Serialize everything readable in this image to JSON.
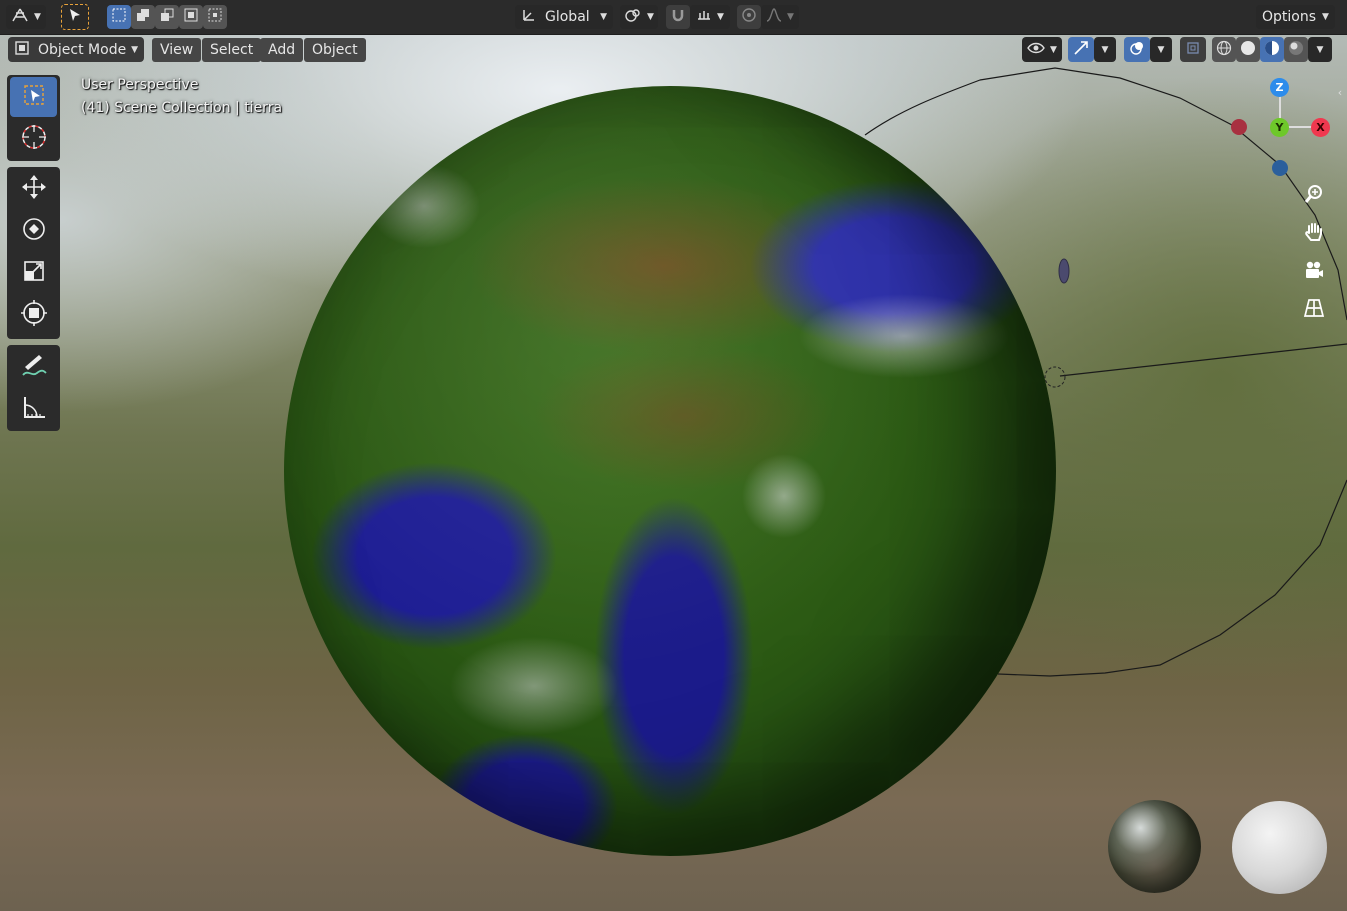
{
  "header": {
    "transform_orientation": "Global",
    "options_label": "Options"
  },
  "viewport_header": {
    "mode_label": "Object Mode",
    "menus": [
      "View",
      "Select",
      "Add",
      "Object"
    ]
  },
  "overlay": {
    "view_name": "User Perspective",
    "collection_info": "(41) Scene Collection | tierra"
  },
  "gizmo": {
    "z": "Z",
    "y": "Y",
    "x": "X",
    "colors": {
      "x": "#f0384f",
      "y": "#6ec82a",
      "z": "#2d8ceb"
    }
  },
  "icons": {
    "toolbar": [
      "select-box-icon",
      "cursor-icon",
      "move-icon",
      "rotate-icon",
      "scale-icon",
      "transform-icon",
      "annotate-icon",
      "measure-icon"
    ],
    "nav": [
      "zoom-icon",
      "hand-pan-icon",
      "camera-icon",
      "grid-view-icon"
    ]
  },
  "colors": {
    "accent": "#4772b3",
    "header_bg": "#2b2b2b",
    "button_bg": "#545454"
  }
}
